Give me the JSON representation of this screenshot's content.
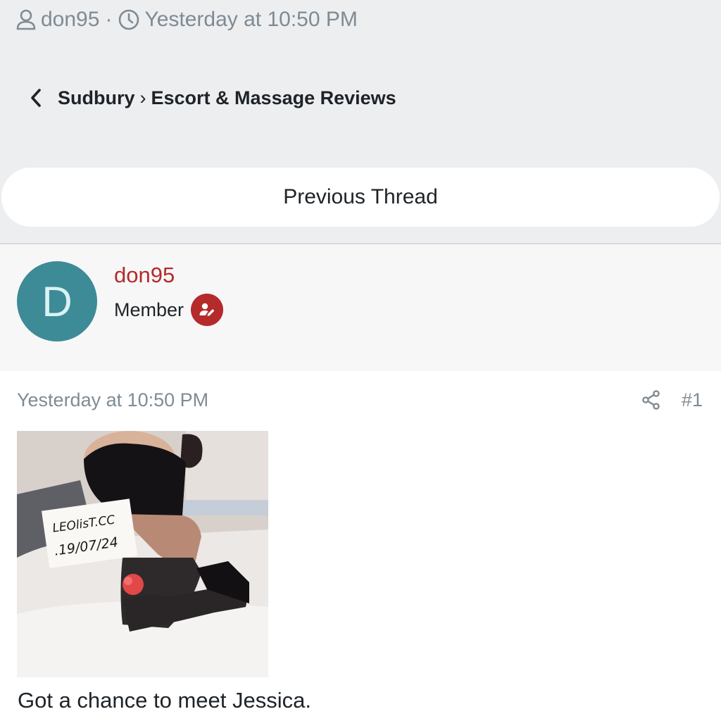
{
  "meta": {
    "author": "don95",
    "separator": "·",
    "timestamp": "Yesterday at 10:50 PM",
    "user_icon": "user-icon",
    "clock_icon": "clock-icon"
  },
  "breadcrumb": {
    "back_icon": "chevron-left-icon",
    "forum": "Sudbury",
    "separator": "›",
    "section": "Escort & Massage Reviews"
  },
  "navigation": {
    "previous_thread": "Previous Thread"
  },
  "author": {
    "initial": "D",
    "name": "don95",
    "role": "Member",
    "avatar_color": "#3d8b96",
    "name_color": "#b52a2a",
    "badge_icon": "member-badge-icon"
  },
  "post": {
    "date": "Yesterday at 10:50 PM",
    "share_icon": "share-icon",
    "number": "#1",
    "image_caption_line1": "LEOlisT.CC",
    "image_caption_line2": ".19/07/24",
    "text": "Got a chance to meet Jessica."
  }
}
